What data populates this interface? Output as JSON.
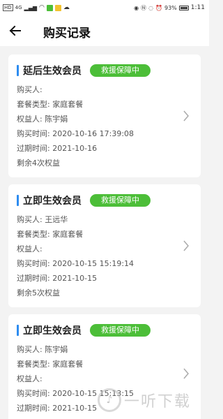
{
  "status_bar": {
    "left_icons": [
      "HD",
      "4G",
      "signal",
      "wifi",
      "chat-app",
      "folder-app",
      "cloud"
    ],
    "right_icons": [
      "eye",
      "nfc",
      "mute",
      "alarm"
    ],
    "battery": "93%",
    "time": "1:11"
  },
  "header": {
    "back_icon": "arrow-left-icon",
    "title": "购买记录"
  },
  "labels": {
    "buyer": "购买人:",
    "package_type": "套餐类型:",
    "beneficiary": "权益人:",
    "purchase_time": "购买时间:",
    "expire_time": "过期时间:"
  },
  "records": [
    {
      "title": "延后生效会员",
      "badge": "救援保障中",
      "buyer": "",
      "package_type": "家庭套餐",
      "beneficiary": "陈宇娟",
      "purchase_time": "2020-10-16 17:39:08",
      "expire_time": "2021-10-16",
      "remaining": "剩余4次权益"
    },
    {
      "title": "立即生效会员",
      "badge": "救援保障中",
      "buyer": "王远华",
      "package_type": "家庭套餐",
      "beneficiary": "",
      "purchase_time": "2020-10-15 15:19:14",
      "expire_time": "2021-10-15",
      "remaining": "剩余5次权益"
    },
    {
      "title": "立即生效会员",
      "badge": "救援保障中",
      "buyer": "陈宇娟",
      "package_type": "家庭套餐",
      "beneficiary": "",
      "purchase_time": "2020-10-15 15:13:15",
      "expire_time": "2021-10-15",
      "remaining": ""
    }
  ],
  "watermark": {
    "text": "一听下载"
  },
  "colors": {
    "accent_blue": "#2d8cf0",
    "badge_green": "#4cbe38"
  }
}
